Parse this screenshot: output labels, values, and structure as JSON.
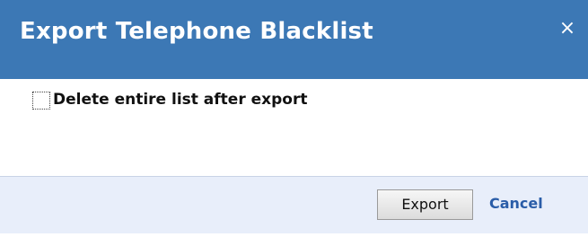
{
  "dialog": {
    "title": "Export Telephone Blacklist",
    "close_glyph": "×",
    "close_icon": "close-icon"
  },
  "options": {
    "delete_after_export": {
      "label": "Delete entire list after export",
      "checked": false
    }
  },
  "footer": {
    "export_label": "Export",
    "cancel_label": "Cancel"
  },
  "colors": {
    "titlebar": "#3C78B5",
    "footer_background": "#E8EEFA",
    "link": "#2A5DA8"
  }
}
